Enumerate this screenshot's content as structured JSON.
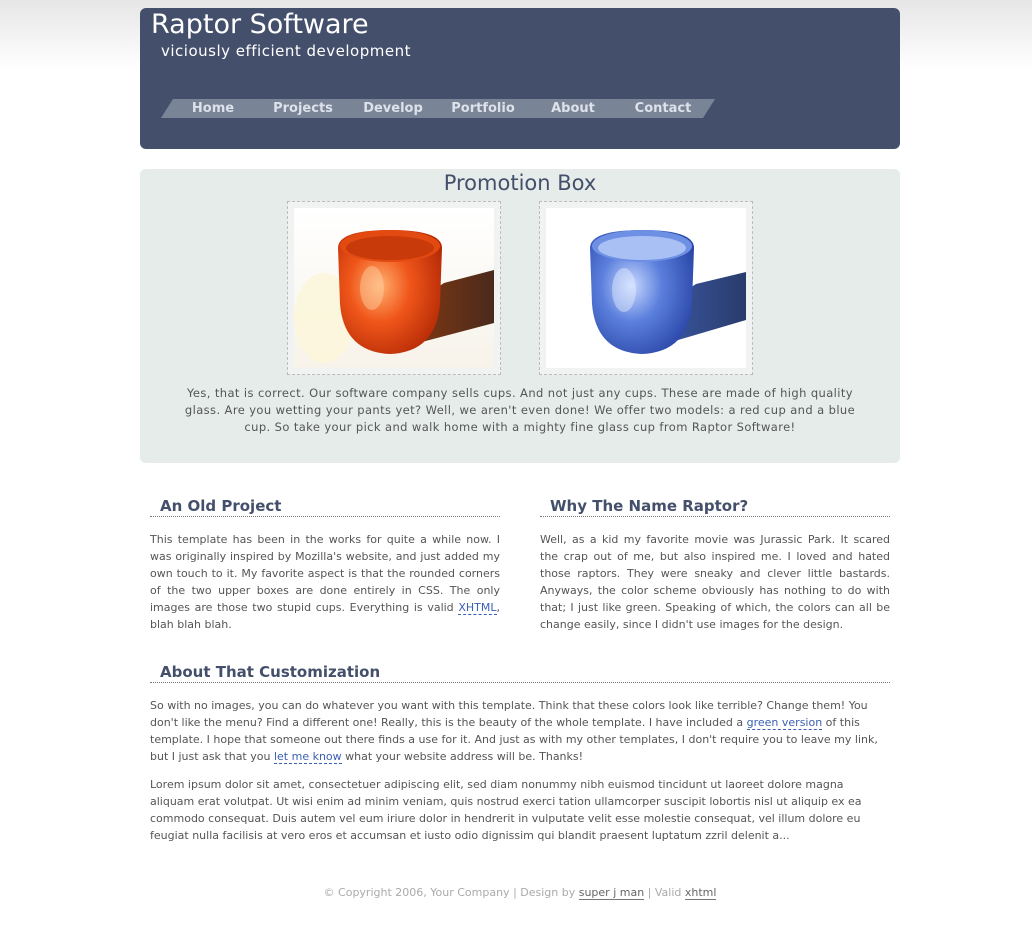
{
  "header": {
    "title": "Raptor Software",
    "tagline": "viciously efficient development",
    "colors": {
      "header_bg": "#444f6b",
      "tab_bg": "#7a8497",
      "tab_text": "#dde2ea"
    },
    "nav": [
      {
        "label": "Home"
      },
      {
        "label": "Projects"
      },
      {
        "label": "Develop"
      },
      {
        "label": "Portfolio"
      },
      {
        "label": "About"
      },
      {
        "label": "Contact"
      }
    ]
  },
  "promo": {
    "title": "Promotion Box",
    "images": [
      {
        "icon": "orange-glass-cup-image"
      },
      {
        "icon": "blue-glass-cup-image"
      }
    ],
    "text": "Yes, that is correct. Our software company sells cups. And not just any cups. These are made of high quality glass. Are you wetting your pants yet? Well, we aren't even done! We offer two models: a red cup and a blue cup. So take your pick and walk home with a mighty fine glass cup from Raptor Software!"
  },
  "sections": {
    "old_project": {
      "heading": "An Old Project",
      "text_before": "This template has been in the works for quite a while now. I was originally inspired by Mozilla's website, and just added my own touch to it. My favorite aspect is that the rounded corners of the two upper boxes are done entirely in CSS. The only images are those two stupid cups. Everything is valid ",
      "link": "XHTML",
      "text_after": ", blah blah blah."
    },
    "why_raptor": {
      "heading": "Why The Name Raptor?",
      "text": "Well, as a kid my favorite movie was Jurassic Park. It scared the crap out of me, but also inspired me. I loved and hated those raptors. They were sneaky and clever little bastards. Anyways, the color scheme obviously has nothing to do with that; I just like green. Speaking of which, the colors can all be change easily, since I didn't use images for the design."
    },
    "customization": {
      "heading": "About That Customization",
      "p1_a": "So with no images, you can do whatever you want with this template. Think that these colors look like terrible? Change them! You don't like the menu? Find a different one! Really, this is the beauty of the whole template. I have included a ",
      "p1_link1": "green version",
      "p1_b": " of this template. I hope that someone out there finds a use for it. And just as with my other templates, I don't require you to leave my link, but I just ask that you ",
      "p1_link2": "let me know",
      "p1_c": " what your website address will be. Thanks!",
      "p2": "Lorem ipsum dolor sit amet, consectetuer adipiscing elit, sed diam nonummy nibh euismod tincidunt ut laoreet dolore magna aliquam erat volutpat. Ut wisi enim ad minim veniam, quis nostrud exerci tation ullamcorper suscipit lobortis nisl ut aliquip ex ea commodo consequat. Duis autem vel eum iriure dolor in hendrerit in vulputate velit esse molestie consequat, vel illum dolore eu feugiat nulla facilisis at vero eros et accumsan et iusto odio dignissim qui blandit praesent luptatum zzril delenit a..."
    }
  },
  "footer": {
    "copyright": "© Copyright 2006, Your Company | Design by ",
    "designer_link": "super j man",
    "separator": " | Valid ",
    "valid_link": "xhtml"
  }
}
